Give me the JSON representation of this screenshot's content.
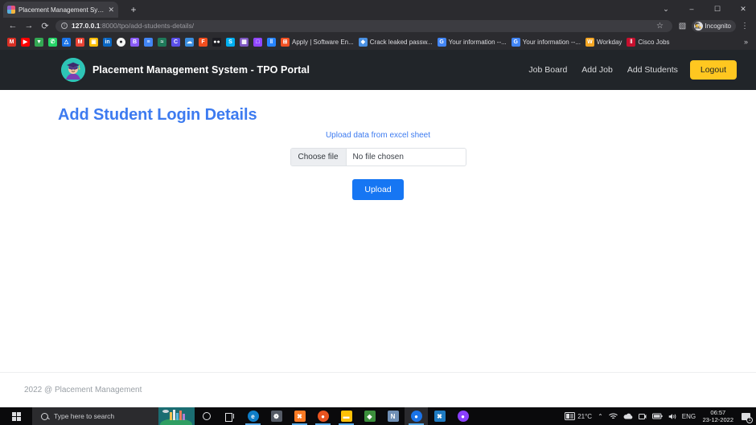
{
  "browser": {
    "tab": {
      "title": "Placement Management System",
      "favicon": "site-favicon",
      "close": "✕"
    },
    "new_tab": "+",
    "window_controls": {
      "minimize_group": "⌄",
      "minimize": "–",
      "maximize": "☐",
      "close": "✕"
    },
    "nav": {
      "back": "←",
      "forward": "→",
      "reload": "⟳"
    },
    "omnibox": {
      "info_icon": "ⓘ",
      "url_host": "127.0.0.1",
      "url_path": ":8000/tpo/add-students-details/",
      "star": "☆",
      "sidepanel": "▧",
      "menu": "⋮"
    },
    "incognito": {
      "label": "Incognito",
      "avatar": "incognito-avatar"
    },
    "bookmarks": [
      {
        "label": "",
        "icon": "gmail-icon",
        "glyph": "M",
        "color": "#d93025"
      },
      {
        "label": "",
        "icon": "youtube-icon",
        "glyph": "▶",
        "color": "#ff0000"
      },
      {
        "label": "",
        "icon": "google-maps-icon",
        "glyph": "▼",
        "color": "#34a853"
      },
      {
        "label": "",
        "icon": "whatsapp-icon",
        "glyph": "✆",
        "color": "#25d366"
      },
      {
        "label": "",
        "icon": "google-drive-icon",
        "glyph": "△",
        "color": "#1a73e8"
      },
      {
        "label": "",
        "icon": "gmail-m-icon",
        "glyph": "M",
        "color": "#ea4335"
      },
      {
        "label": "",
        "icon": "photos-icon",
        "glyph": "▣",
        "color": "#fbbc04"
      },
      {
        "label": "",
        "icon": "linkedin-icon",
        "glyph": "in",
        "color": "#0a66c2"
      },
      {
        "label": "",
        "icon": "github-icon",
        "glyph": "●",
        "color": "#f5f5f5"
      },
      {
        "label": "",
        "icon": "bitbucket-icon",
        "glyph": "B",
        "color": "#8b5cf6"
      },
      {
        "label": "",
        "icon": "docs-icon",
        "glyph": "≡",
        "color": "#4285f4"
      },
      {
        "label": "",
        "icon": "leetcode-icon",
        "glyph": "≈",
        "color": "#1f7a5a"
      },
      {
        "label": "",
        "icon": "coursera-icon",
        "glyph": "C",
        "color": "#5b4fe9"
      },
      {
        "label": "",
        "icon": "cloud-icon",
        "glyph": "☁",
        "color": "#3a8dde"
      },
      {
        "label": "",
        "icon": "figma-icon",
        "glyph": "F",
        "color": "#f24e1e"
      },
      {
        "label": "",
        "icon": "discord-icon",
        "glyph": "●●",
        "color": "#1c1c22"
      },
      {
        "label": "",
        "icon": "skype-icon",
        "glyph": "S",
        "color": "#00aff0"
      },
      {
        "label": "",
        "icon": "slides-icon",
        "glyph": "▦",
        "color": "#7e57c2"
      },
      {
        "label": "",
        "icon": "twitch-icon",
        "glyph": "□",
        "color": "#9146ff"
      },
      {
        "label": "",
        "icon": "trello-icon",
        "glyph": "‖",
        "color": "#2684ff"
      },
      {
        "label": "Apply | Software En...",
        "icon": "microsoft-icon",
        "glyph": "⊞",
        "color": "#f25022"
      },
      {
        "label": "Crack leaked passw...",
        "icon": "diamond-icon",
        "glyph": "◆",
        "color": "#4a90e2"
      },
      {
        "label": "Your information --...",
        "icon": "google-icon",
        "glyph": "G",
        "color": "#4285f4"
      },
      {
        "label": "Your information --...",
        "icon": "google-icon",
        "glyph": "G",
        "color": "#4285f4"
      },
      {
        "label": "Workday",
        "icon": "workday-icon",
        "glyph": "W",
        "color": "#f5a623"
      },
      {
        "label": "Cisco Jobs",
        "icon": "cisco-icon",
        "glyph": "‖",
        "color": "#c8102e"
      }
    ],
    "bookmarks_overflow": "»"
  },
  "site": {
    "brand": {
      "name": "Placement Management System - TPO Portal",
      "logo": "graduate-avatar-logo"
    },
    "nav_links": [
      {
        "label": "Job Board"
      },
      {
        "label": "Add Job"
      },
      {
        "label": "Add Students"
      }
    ],
    "logout_label": "Logout",
    "page_title": "Add Student Login Details",
    "upload": {
      "caption": "Upload data from excel sheet",
      "choose_file_label": "Choose file",
      "file_name": "No file chosen",
      "submit_label": "Upload"
    },
    "footer_text": "2022 @ Placement Management",
    "colors": {
      "navbar_bg": "#212529",
      "accent_blue": "#3d7bf0",
      "button_blue": "#1676f3",
      "logout_yellow": "#ffc720"
    }
  },
  "taskbar": {
    "start": "windows-start",
    "search_placeholder": "Type here to search",
    "cortana": "cortana-icon",
    "task_view": "task-view-icon",
    "apps": [
      {
        "name": "microsoft-edge",
        "glyph": "e",
        "color": "#0f7ec8",
        "active": false,
        "running": true
      },
      {
        "name": "photos",
        "glyph": "❁",
        "color": "#555b66",
        "active": false,
        "running": false
      },
      {
        "name": "xampp",
        "glyph": "✖",
        "color": "#fb7a24",
        "active": false,
        "running": true
      },
      {
        "name": "ubuntu",
        "glyph": "●",
        "color": "#e95420",
        "active": false,
        "running": true
      },
      {
        "name": "file-explorer",
        "glyph": "▬",
        "color": "#ffc107",
        "active": false,
        "running": true
      },
      {
        "name": "visio",
        "glyph": "◆",
        "color": "#3c8f3c",
        "active": false,
        "running": false
      },
      {
        "name": "onenote",
        "glyph": "N",
        "color": "#6f8fb5",
        "active": false,
        "running": false
      },
      {
        "name": "google-chrome",
        "glyph": "●",
        "color": "#1a73e8",
        "active": true,
        "running": true
      },
      {
        "name": "visual-studio-code",
        "glyph": "✖",
        "color": "#1f7bc1",
        "active": false,
        "running": false
      },
      {
        "name": "github-desktop",
        "glyph": "●",
        "color": "#8a3ffc",
        "active": false,
        "running": false
      }
    ],
    "tray": {
      "weather": "21°C",
      "weather_icon": "weather-card-icon",
      "chevron": "⌃",
      "wifi": "wifi-icon",
      "onedrive": "onedrive-icon",
      "network": "network-icon",
      "battery": "battery-icon",
      "volume": "volume-icon",
      "language": "ENG",
      "time": "06:57",
      "date": "23-12-2022",
      "notification_count": "1"
    }
  }
}
